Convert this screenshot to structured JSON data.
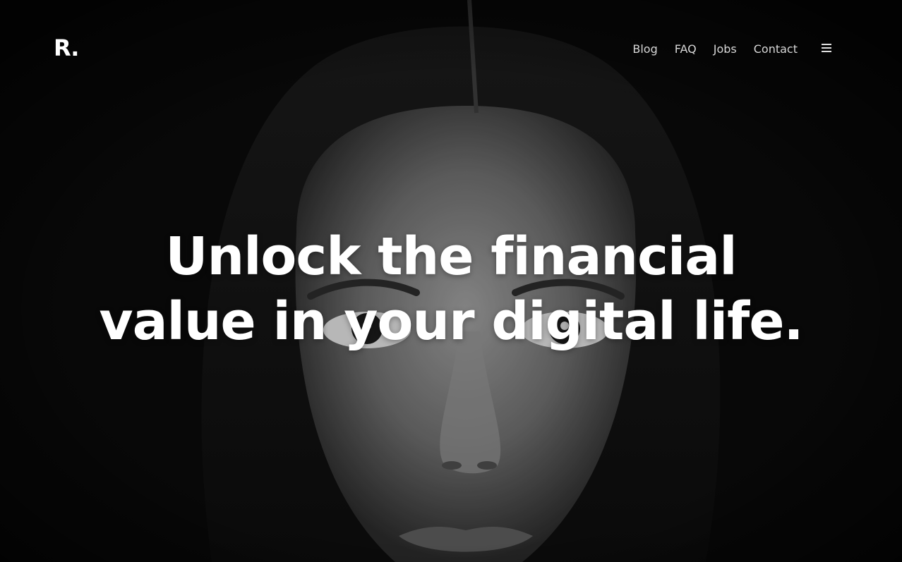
{
  "brand": {
    "logo_text": "R."
  },
  "nav": {
    "items": [
      {
        "label": "Blog"
      },
      {
        "label": "FAQ"
      },
      {
        "label": "Jobs"
      },
      {
        "label": "Contact"
      }
    ],
    "menu_icon": "hamburger-menu-icon"
  },
  "hero": {
    "headline_line1": "Unlock the financial",
    "headline_line2": "value in your digital life.",
    "background_image": "grayscale-portrait-photo"
  },
  "colors": {
    "background": "#0b0b0b",
    "text": "#ffffff",
    "nav_text": "#d8d8d8"
  }
}
